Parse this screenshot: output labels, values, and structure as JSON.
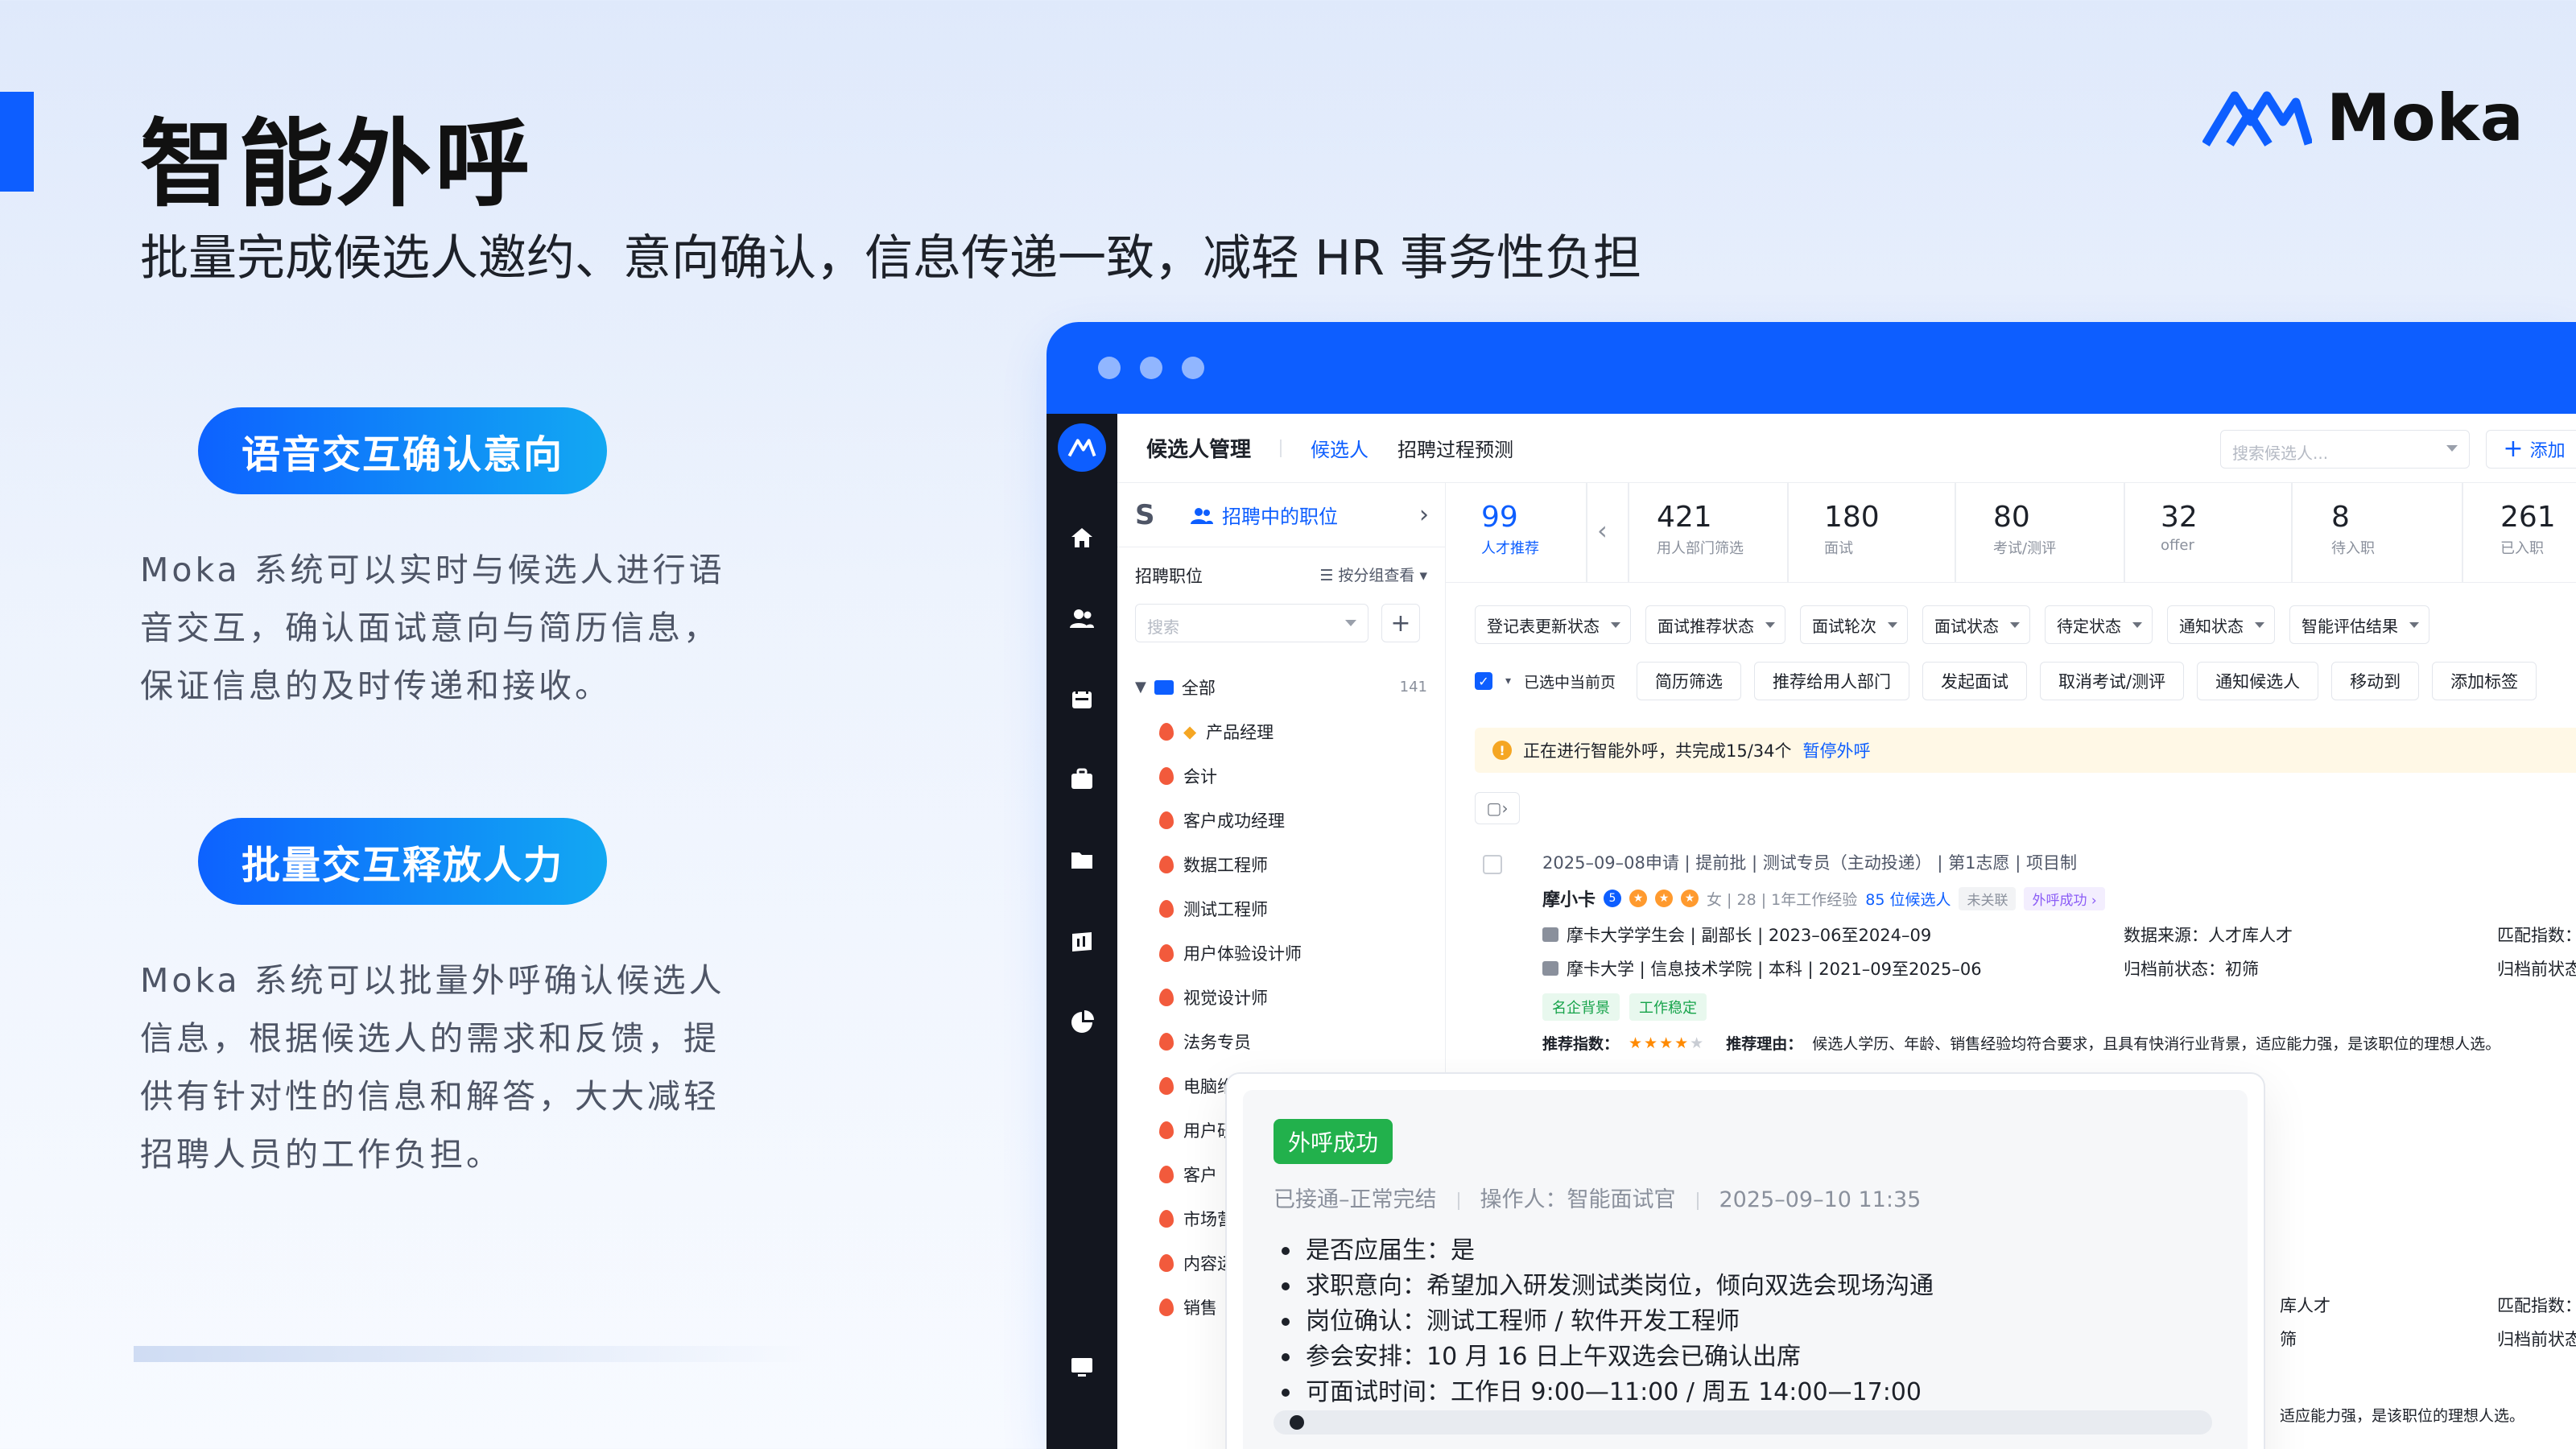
{
  "header": {
    "title": "智能外呼",
    "subtitle": "批量完成候选人邀约、意向确认，信息传递一致，减轻 HR 事务性负担",
    "logo_text": "Moka"
  },
  "features": [
    {
      "label": "语音交互确认意向",
      "desc": "Moka 系统可以实时与候选人进行语音交互，确认面试意向与简历信息，保证信息的及时传递和接收。"
    },
    {
      "label": "批量交互释放人力",
      "desc": "Moka 系统可以批量外呼确认候选人信息，根据候选人的需求和反馈，提供有针对性的信息和解答，大大减轻招聘人员的工作负担。"
    }
  ],
  "colors": {
    "brand": "#0d5eff",
    "success": "#22b14c",
    "warning": "#f5a623"
  },
  "app": {
    "topnav": {
      "title": "候选人管理",
      "tabs": [
        "候选人",
        "招聘过程预测"
      ],
      "search_placeholder": "搜索候选人...",
      "add_label": "添加"
    },
    "left": {
      "tab_label": "招聘中的职位",
      "section_label": "招聘职位",
      "group_label": "按分组查看",
      "search_placeholder": "搜索",
      "root_label": "全部",
      "root_count": "141",
      "jobs": [
        "产品经理",
        "会计",
        "客户成功经理",
        "数据工程师",
        "测试工程师",
        "用户体验设计师",
        "视觉设计师",
        "法务专员",
        "电脑维",
        "用户研",
        "客户",
        "市场营",
        "内容运",
        "销售"
      ]
    },
    "stats": [
      {
        "num": "99",
        "label": "人才推荐"
      },
      {
        "num": "421",
        "label": "用人部门筛选"
      },
      {
        "num": "180",
        "label": "面试"
      },
      {
        "num": "80",
        "label": "考试/测评"
      },
      {
        "num": "32",
        "label": "offer"
      },
      {
        "num": "8",
        "label": "待入职"
      },
      {
        "num": "261",
        "label": "已入职"
      }
    ],
    "filters": [
      "登记表更新状态",
      "面试推荐状态",
      "面试轮次",
      "面试状态",
      "待定状态",
      "通知状态",
      "智能评估结果"
    ],
    "actions": {
      "select_label": "已选中当前页",
      "buttons": [
        "简历筛选",
        "推荐给用人部门",
        "发起面试",
        "取消考试/测评",
        "通知候选人",
        "移动到",
        "添加标签"
      ]
    },
    "notice": {
      "text": "正在进行智能外呼，共完成15/34个",
      "link": "暂停外呼"
    },
    "candidate": {
      "meta": "2025–09–08申请 | 提前批 | 测试专员（主动投递） | 第1志愿 | 项目制",
      "name": "摩小卡",
      "badge_num": "5",
      "info": "女 | 28 | 1年工作经验",
      "recommend": "85 位候选人",
      "unlinked": "未关联",
      "call_status": "外呼成功",
      "edu1": "摩卡大学学生会 | 副部长 | 2023–06至2024–09",
      "edu2": "摩卡大学 | 信息技术学院 | 本科 | 2021–09至2025–06",
      "source": "数据来源：人才库人才",
      "archive": "归档前状态：初筛",
      "match": "匹配指数：",
      "archive2": "归档前状态：",
      "tags": [
        "名企背景",
        "工作稳定"
      ],
      "rec_label": "推荐指数：",
      "rec_reason_label": "推荐理由：",
      "rec_reason": "候选人学历、年龄、销售经验均符合要求，且具有快消行业背景，适应能力强，是该职位的理想人选。"
    },
    "candidate2": {
      "source_tail": "库人才",
      "archive_tail": "筛",
      "match": "匹配指数：",
      "archive2": "归档前状态：",
      "reason_tail": "适应能力强，是该职位的理想人选。"
    }
  },
  "popup": {
    "status": "外呼成功",
    "meta_connect": "已接通–正常完结",
    "meta_operator": "操作人：智能面试官",
    "meta_time": "2025–09–10 11:35",
    "items": [
      "是否应届生：是",
      "求职意向：希望加入研发测试类岗位，倾向双选会现场沟通",
      "岗位确认：测试工程师 / 软件开发工程师",
      "参会安排：10 月 16 日上午双选会已确认出席",
      "可面试时间：工作日 9:00—11:00 / 周五 14:00—17:00"
    ]
  }
}
